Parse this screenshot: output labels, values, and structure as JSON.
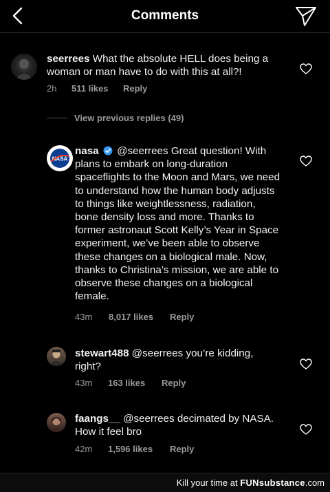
{
  "header": {
    "title": "Comments",
    "back_icon": "chevron-left-icon",
    "send_icon": "send-icon"
  },
  "comments": [
    {
      "username": "seerrees",
      "text": "What the absolute HELL does being a woman or man have to do with this at all?!",
      "time": "2h",
      "likes": "511 likes",
      "reply": "Reply"
    },
    {
      "username": "nasa",
      "verified": true,
      "text": "@seerrees Great question! With plans to embark on long-duration spaceflights to the Moon and Mars, we need to understand how the human body adjusts to things like weightlessness, radiation, bone density loss and more. Thanks to former astronaut Scott Kelly’s Year in Space experiment, we’ve been able to observe these changes on a biological male. Now, thanks to Christina’s mission, we are able to observe these changes on a biological female.",
      "time": "43m",
      "likes": "8,017 likes",
      "reply": "Reply"
    },
    {
      "username": "stewart488",
      "text": "@seerrees you’re kidding, right?",
      "time": "43m",
      "likes": "163 likes",
      "reply": "Reply"
    },
    {
      "username": "faangs__",
      "text": "@seerrees decimated by NASA. How it feel bro",
      "time": "42m",
      "likes": "1,596 likes",
      "reply": "Reply"
    }
  ],
  "view_previous": "View previous replies (49)",
  "footer": {
    "prefix": "Kill your time at",
    "brand": "FUNsubstance",
    "suffix": ".com"
  },
  "colors": {
    "background": "#000000",
    "meta": "#9a9a9a",
    "verified": "#3897f0"
  }
}
